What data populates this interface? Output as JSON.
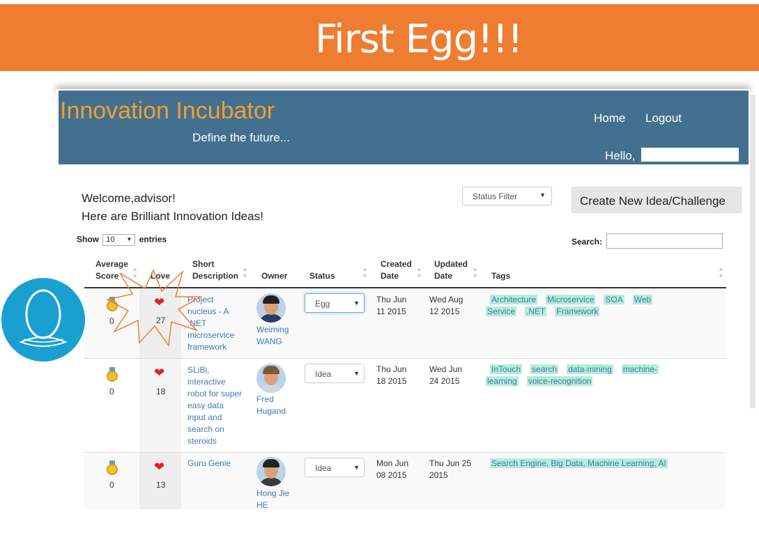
{
  "banner": {
    "title": "First Egg!!!"
  },
  "header": {
    "brand": "Innovation Incubator",
    "tagline": "Define the future...",
    "nav": {
      "home": "Home",
      "logout": "Logout"
    },
    "hello": "Hello,"
  },
  "welcome": {
    "line1": "Welcome,advisor!",
    "line2": "Here are Brilliant Innovation Ideas!"
  },
  "status_filter": {
    "label": "Status Filter"
  },
  "create_button": {
    "label": "Create New Idea/Challenge"
  },
  "table_controls": {
    "show_label": "Show",
    "entries_value": "10",
    "entries_label": "entries",
    "search_label": "Search:"
  },
  "columns": {
    "avg_score_1": "Average",
    "avg_score_2": "Score",
    "love": "Love",
    "short_desc_1": "Short",
    "short_desc_2": "Description",
    "owner": "Owner",
    "status": "Status",
    "created_1": "Created",
    "created_2": "Date",
    "updated_1": "Updated",
    "updated_2": "Date",
    "tags": "Tags"
  },
  "rows": [
    {
      "score": "0",
      "love": "27",
      "desc": [
        "Project",
        "nucleus - A",
        ".NET",
        "microservice",
        "framework"
      ],
      "owner": [
        "Weiming",
        "WANG"
      ],
      "status": "Egg",
      "created": [
        "Thu Jun",
        "11 2015"
      ],
      "updated": [
        "Wed Aug",
        "12 2015"
      ],
      "tags": [
        "Architecture",
        "Microservice",
        "SOA",
        "Web",
        "Service",
        ".NET",
        "Framework"
      ]
    },
    {
      "score": "0",
      "love": "18",
      "desc": [
        "SLiBi,",
        "interactive",
        "robot for super",
        "easy data",
        "input and",
        "search on",
        "steroids"
      ],
      "owner": [
        "Fred",
        "Hugand"
      ],
      "status": "Idea",
      "created": [
        "Thu Jun",
        "18 2015"
      ],
      "updated": [
        "Wed Jun",
        "24 2015"
      ],
      "tags": [
        "InTouch",
        "search",
        "data-mining",
        "machine-",
        "learning",
        "voice-recognition"
      ]
    },
    {
      "score": "0",
      "love": "13",
      "desc": [
        "Guru Genie"
      ],
      "owner": [
        "Hong Jie",
        "HE"
      ],
      "status": "Idea",
      "created": [
        "Mon Jun",
        "08 2015"
      ],
      "updated": [
        "Thu Jun 25",
        "2015"
      ],
      "tags": [
        "Search Engine, Big Data, Machine Learning, AI"
      ]
    }
  ],
  "icons": {
    "medal": "medal-icon",
    "heart": "heart-icon",
    "egg_logo": "egg-logo",
    "sort": "sort-icon",
    "caret": "caret-down-icon"
  },
  "colors": {
    "banner": "#ee7d32",
    "header": "#44708f",
    "brand": "#f0a030",
    "tag_bg": "#b7ecd9",
    "link": "#3e7bb0",
    "heart": "#e0241d",
    "egg_logo": "#1aa0d0"
  }
}
